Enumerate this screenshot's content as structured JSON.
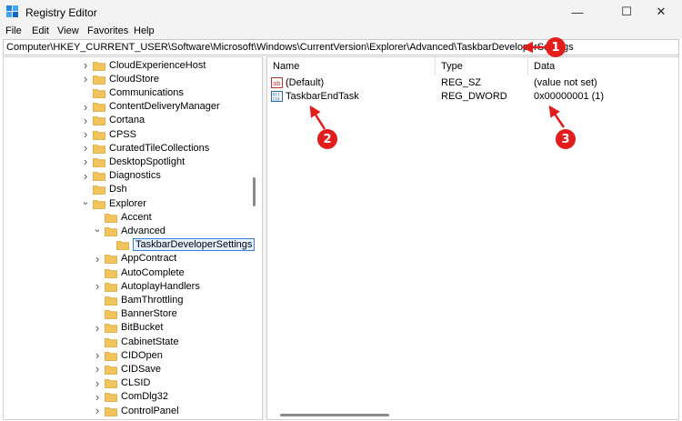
{
  "window": {
    "title": "Registry Editor",
    "minimize_glyph": "—",
    "maximize_glyph": "☐",
    "close_glyph": "✕"
  },
  "menu": [
    "File",
    "Edit",
    "View",
    "Favorites",
    "Help"
  ],
  "address": "Computer\\HKEY_CURRENT_USER\\Software\\Microsoft\\Windows\\CurrentVersion\\Explorer\\Advanced\\TaskbarDeveloperSettings",
  "tree": {
    "items": [
      {
        "label": "CloudExperienceHost",
        "level": 0,
        "expander": "right"
      },
      {
        "label": "CloudStore",
        "level": 0,
        "expander": "right"
      },
      {
        "label": "Communications",
        "level": 0,
        "expander": "none"
      },
      {
        "label": "ContentDeliveryManager",
        "level": 0,
        "expander": "right"
      },
      {
        "label": "Cortana",
        "level": 0,
        "expander": "right"
      },
      {
        "label": "CPSS",
        "level": 0,
        "expander": "right"
      },
      {
        "label": "CuratedTileCollections",
        "level": 0,
        "expander": "right"
      },
      {
        "label": "DesktopSpotlight",
        "level": 0,
        "expander": "right"
      },
      {
        "label": "Diagnostics",
        "level": 0,
        "expander": "right"
      },
      {
        "label": "Dsh",
        "level": 0,
        "expander": "none"
      },
      {
        "label": "Explorer",
        "level": 0,
        "expander": "down"
      },
      {
        "label": "Accent",
        "level": 1,
        "expander": "none"
      },
      {
        "label": "Advanced",
        "level": 1,
        "expander": "down"
      },
      {
        "label": "TaskbarDeveloperSettings",
        "level": 2,
        "expander": "none",
        "selected": true
      },
      {
        "label": "AppContract",
        "level": 1,
        "expander": "right"
      },
      {
        "label": "AutoComplete",
        "level": 1,
        "expander": "none"
      },
      {
        "label": "AutoplayHandlers",
        "level": 1,
        "expander": "right"
      },
      {
        "label": "BamThrottling",
        "level": 1,
        "expander": "none"
      },
      {
        "label": "BannerStore",
        "level": 1,
        "expander": "none"
      },
      {
        "label": "BitBucket",
        "level": 1,
        "expander": "right"
      },
      {
        "label": "CabinetState",
        "level": 1,
        "expander": "none"
      },
      {
        "label": "CIDOpen",
        "level": 1,
        "expander": "right"
      },
      {
        "label": "CIDSave",
        "level": 1,
        "expander": "right"
      },
      {
        "label": "CLSID",
        "level": 1,
        "expander": "right"
      },
      {
        "label": "ComDlg32",
        "level": 1,
        "expander": "right"
      },
      {
        "label": "ControlPanel",
        "level": 1,
        "expander": "right"
      }
    ]
  },
  "values": {
    "headers": {
      "name": "Name",
      "type": "Type",
      "data": "Data"
    },
    "rows": [
      {
        "name": "(Default)",
        "type": "REG_SZ",
        "data": "(value not set)",
        "icon": "string-value-icon"
      },
      {
        "name": "TaskbarEndTask",
        "type": "REG_DWORD",
        "data": "0x00000001 (1)",
        "icon": "dword-value-icon"
      }
    ]
  },
  "annotations": [
    "1",
    "2",
    "3"
  ],
  "colors": {
    "annotation": "#e31c1c",
    "selection_border": "#3b7fd8",
    "folder": "#f2c45c"
  }
}
